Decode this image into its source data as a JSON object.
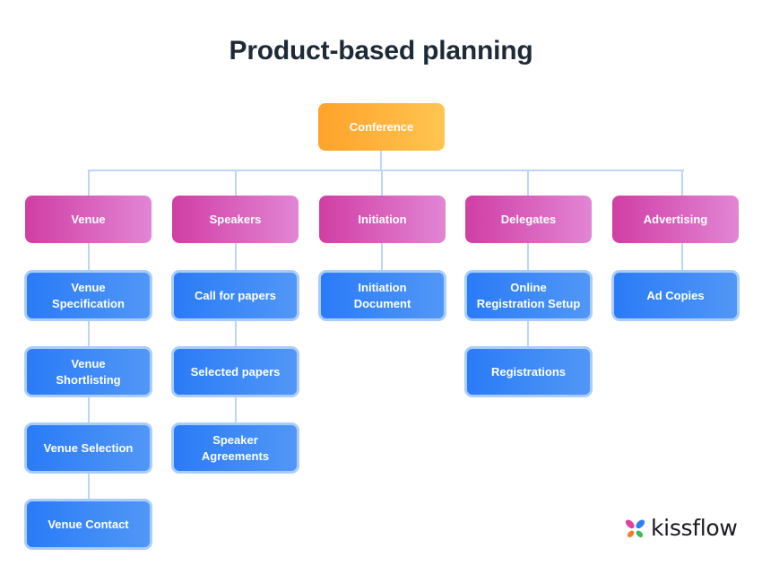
{
  "title": "Product-based planning",
  "root": {
    "label": "Conference"
  },
  "categories": [
    {
      "label": "Venue",
      "items": [
        "Venue\nSpecification",
        "Venue\nShortlisting",
        "Venue Selection",
        "Venue Contact"
      ]
    },
    {
      "label": "Speakers",
      "items": [
        "Call for papers",
        "Selected papers",
        "Speaker\nAgreements"
      ]
    },
    {
      "label": "Initiation",
      "items": [
        "Initiation\nDocument"
      ]
    },
    {
      "label": "Delegates",
      "items": [
        "Online\nRegistration Setup",
        "Registrations"
      ]
    },
    {
      "label": "Advertising",
      "items": [
        "Ad Copies"
      ]
    }
  ],
  "brand": {
    "name": "kissflow",
    "icon": "kissflow-butterfly-icon"
  },
  "colors": {
    "title": "#1e2a38",
    "root": "#ffb33e",
    "category": "#d95fbc",
    "deliverable": "#3a88f7",
    "deliverable_border": "#aacdf8",
    "connector": "#b9d6fa",
    "logo_petals": [
      "#e0409f",
      "#2d7ef7",
      "#f97b2c",
      "#3dba5a"
    ]
  }
}
